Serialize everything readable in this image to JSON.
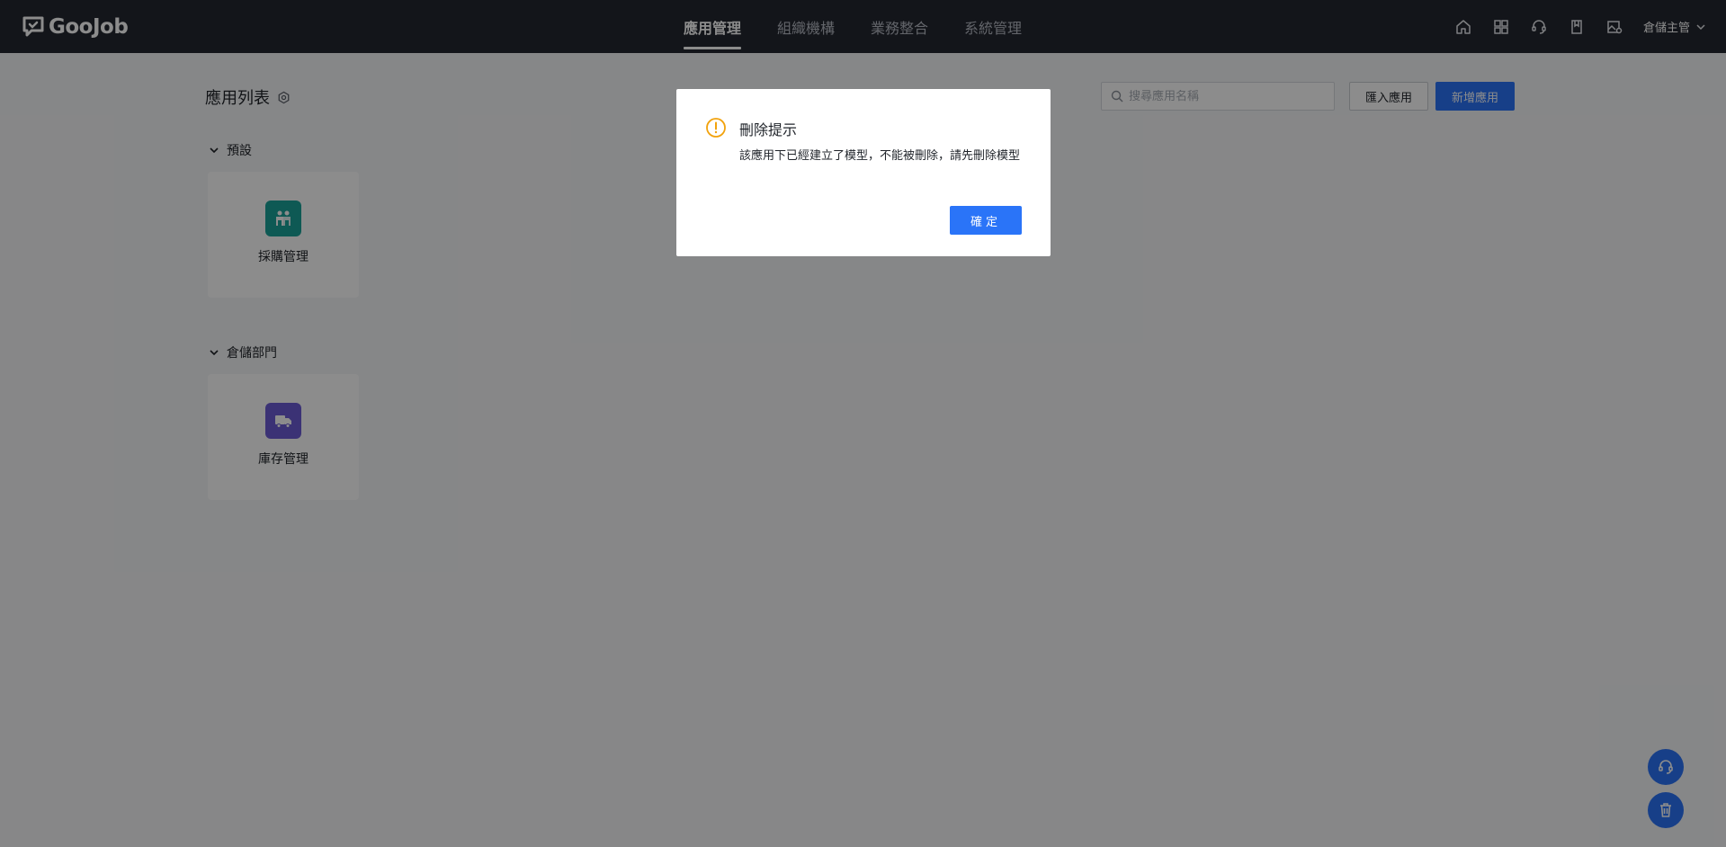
{
  "header": {
    "logo_text": "GooJob",
    "nav": [
      {
        "label": "應用管理",
        "active": true
      },
      {
        "label": "組織機構",
        "active": false
      },
      {
        "label": "業務整合",
        "active": false
      },
      {
        "label": "系統管理",
        "active": false
      }
    ],
    "icons": [
      "home-icon",
      "apps-grid-icon",
      "support-icon",
      "book-icon",
      "image-settings-icon"
    ],
    "user_name": "倉儲主管"
  },
  "main": {
    "title": "應用列表",
    "search": {
      "placeholder": "搜尋應用名稱",
      "value": ""
    },
    "import_label": "匯入應用",
    "new_label": "新增應用",
    "groups": [
      {
        "name": "預設",
        "apps": [
          {
            "label": "採購管理",
            "icon": "purchase-icon",
            "color": "#1aa39a"
          }
        ]
      },
      {
        "name": "倉儲部門",
        "apps": [
          {
            "label": "庫存管理",
            "icon": "truck-icon",
            "color": "#6c5bd6"
          }
        ]
      }
    ]
  },
  "floating": [
    "headset-icon",
    "trash-icon"
  ],
  "dialog": {
    "title": "刪除提示",
    "message": "該應用下已經建立了模型，不能被刪除，請先刪除模型",
    "ok_label": "確定",
    "icon_color": "#f2a20c"
  },
  "colors": {
    "primary": "#2a74f8",
    "header_bg": "#232731"
  }
}
